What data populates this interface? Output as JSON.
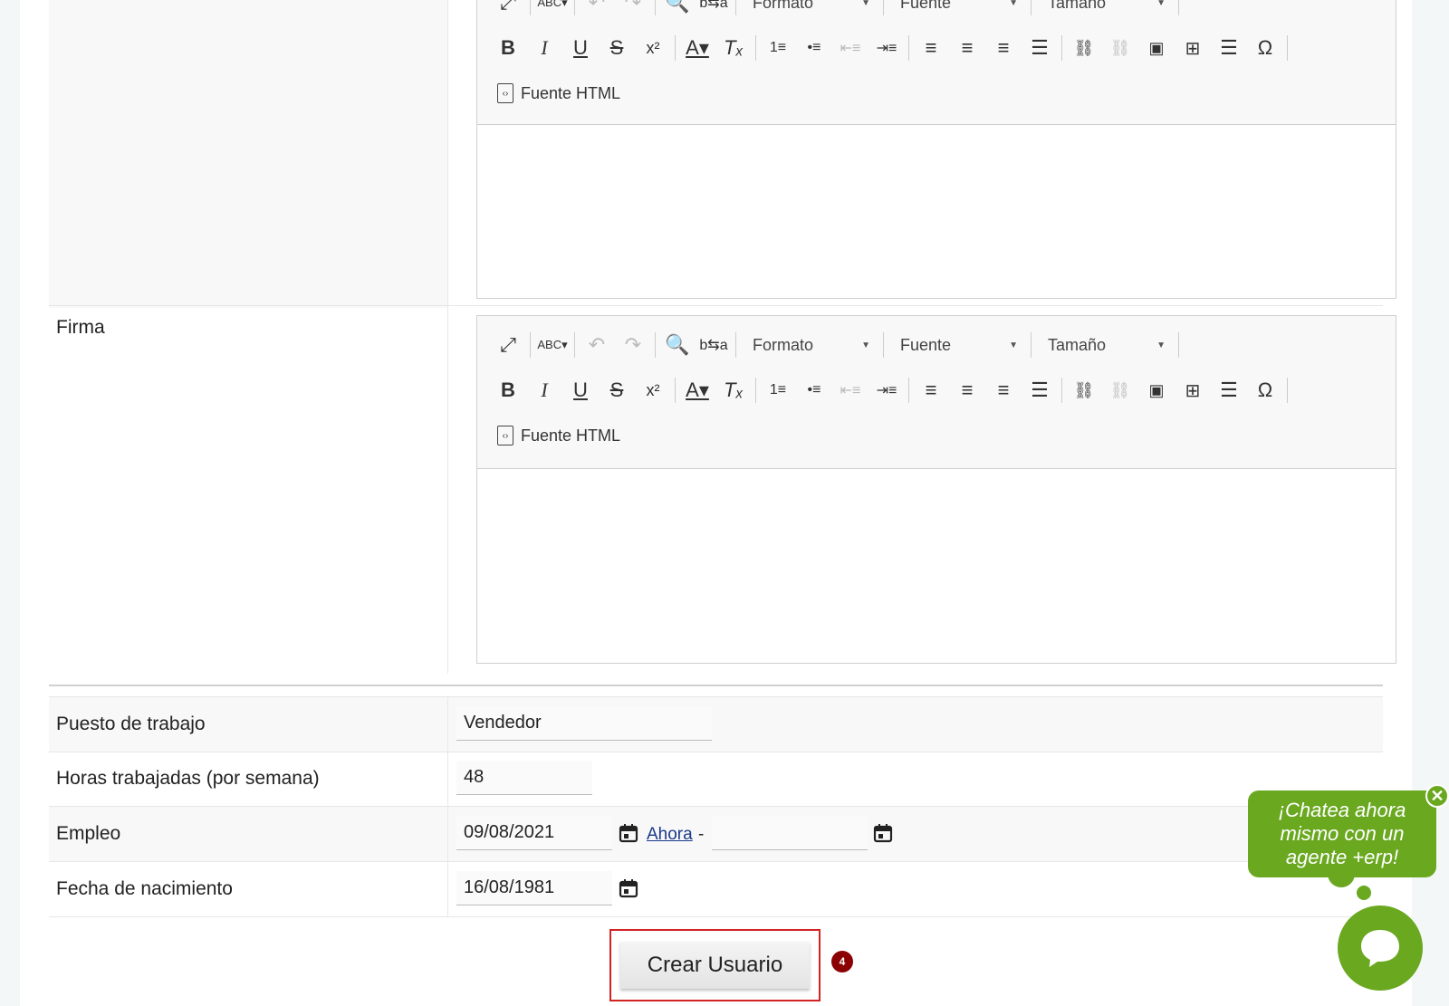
{
  "editor_toolbar": {
    "format_label": "Formato",
    "font_label": "Fuente",
    "size_label": "Tamaño",
    "source_label": "Fuente HTML"
  },
  "firma": {
    "label": "Firma"
  },
  "fields": {
    "puesto": {
      "label": "Puesto de trabajo",
      "value": "Vendedor"
    },
    "horas": {
      "label": "Horas trabajadas (por semana)",
      "value": "48"
    },
    "empleo": {
      "label": "Empleo",
      "start": "09/08/2021",
      "now_link": "Ahora",
      "dash": "-",
      "end": ""
    },
    "nacimiento": {
      "label": "Fecha de nacimiento",
      "value": "16/08/1981"
    }
  },
  "submit": {
    "label": "Crear Usuario",
    "badge": "4"
  },
  "chat": {
    "bubble_text": "¡Chatea ahora mismo con un agente +erp!",
    "close": "✕"
  },
  "colors": {
    "chat_green": "#6aa820",
    "highlight_red": "#d32222",
    "badge_red": "#8b0000"
  }
}
